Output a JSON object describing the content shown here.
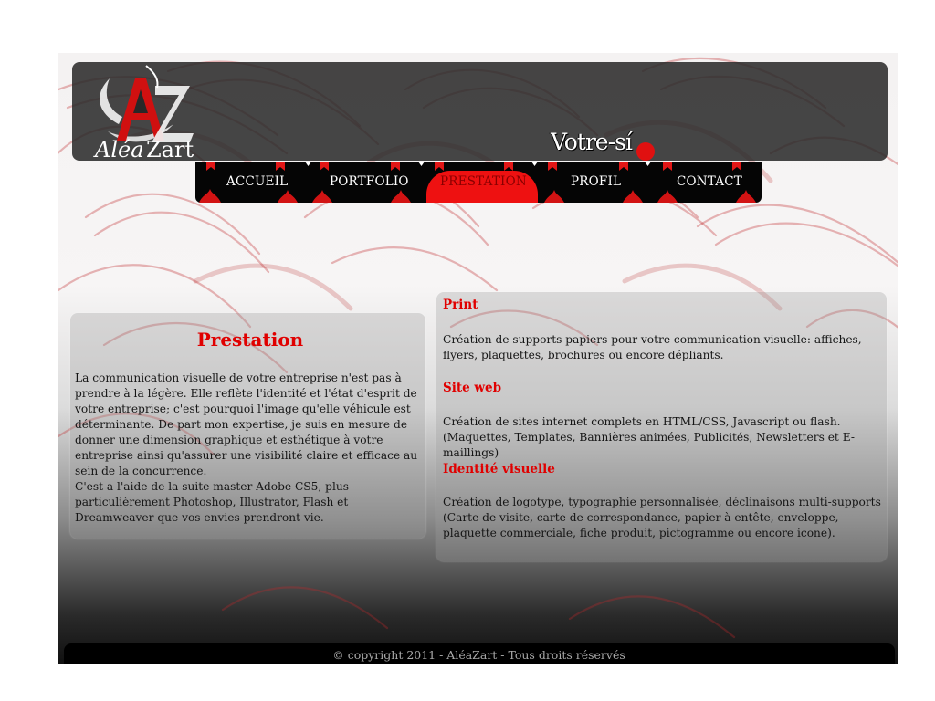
{
  "colors": {
    "accent": "#e00000",
    "nav_bg": "#050505",
    "header_bg": "#282828"
  },
  "header": {
    "logo_text": "AléaZart",
    "logo_mark": "AZ",
    "slogan": "Votre-sí"
  },
  "nav": {
    "items": [
      {
        "label": "ACCUEIL"
      },
      {
        "label": "PORTFOLIO"
      },
      {
        "label": "PRESTATION",
        "active": true
      },
      {
        "label": "PROFIL"
      },
      {
        "label": "CONTACT"
      }
    ]
  },
  "intro": {
    "title": "Prestation",
    "paragraph1": "La communication visuelle de votre entreprise n'est pas à prendre à la légère. Elle reflète l'identité et l'état d'esprit de votre entreprise; c'est pourquoi l'image qu'elle véhicule est déterminante. De part mon expertise, je suis en mesure de donner une dimension graphique et esthétique à votre entreprise ainsi qu'assurer une visibilité claire et efficace au sein de la concurrence.",
    "paragraph2": "C'est a l'aide de la suite master Adobe CS5, plus particulièrement Photoshop, Illustrator, Flash et Dreamweaver que vos envies prendront vie."
  },
  "services": [
    {
      "title": "Print",
      "text": "Création de supports papiers pour votre communication visuelle: affiches, flyers, plaquettes, brochures ou encore dépliants."
    },
    {
      "title": "Site web",
      "text": "Création de sites internet complets en HTML/CSS, Javascript ou flash. (Maquettes, Templates, Bannières animées, Publicités, Newsletters et E-maillings)"
    },
    {
      "title": "Identité visuelle",
      "text": "Création de logotype, typographie personnalisée, déclinaisons multi-supports (Carte de visite, carte de correspondance, papier à entête, enveloppe, plaquette commerciale, fiche produit, pictogramme ou encore icone)."
    }
  ],
  "footer": {
    "text": "© copyright 2011 - AléaZart - Tous droits réservés"
  }
}
